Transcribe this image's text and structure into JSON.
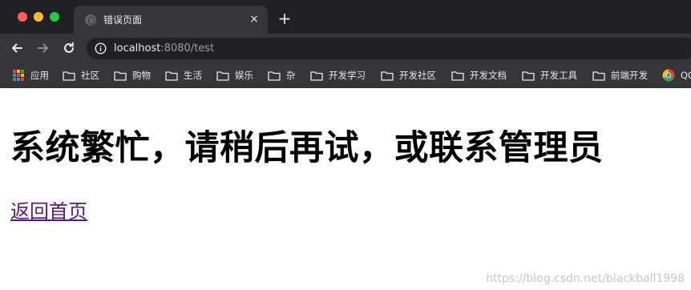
{
  "browser": {
    "tab": {
      "title": "错误页面",
      "close_glyph": "×",
      "favicon": "globe-icon"
    },
    "new_tab_glyph": "+",
    "toolbar": {
      "back_icon": "back-arrow-icon",
      "forward_icon": "forward-arrow-icon",
      "reload_icon": "reload-icon",
      "address": {
        "host": "localhost",
        "rest": ":8080/test",
        "info_icon": "info-icon"
      }
    },
    "bookmarks": [
      {
        "label": "应用",
        "icon": "apps-grid-icon"
      },
      {
        "label": "社区",
        "icon": "folder-icon"
      },
      {
        "label": "购物",
        "icon": "folder-icon"
      },
      {
        "label": "生活",
        "icon": "folder-icon"
      },
      {
        "label": "娱乐",
        "icon": "folder-icon"
      },
      {
        "label": "杂",
        "icon": "folder-icon"
      },
      {
        "label": "开发学习",
        "icon": "folder-icon"
      },
      {
        "label": "开发社区",
        "icon": "folder-icon"
      },
      {
        "label": "开发文档",
        "icon": "folder-icon"
      },
      {
        "label": "开发工具",
        "icon": "folder-icon"
      },
      {
        "label": "前端开发",
        "icon": "folder-icon"
      },
      {
        "label": "QQ",
        "icon": "chrome-icon"
      }
    ],
    "colors": {
      "titlebar": "#202124",
      "toolbar": "#35363a",
      "link_visited": "#551a8b"
    }
  },
  "page": {
    "heading": "系统繁忙，请稍后再试，或联系管理员",
    "home_link": "返回首页",
    "watermark": "https://blog.csdn.net/blackball1998"
  }
}
